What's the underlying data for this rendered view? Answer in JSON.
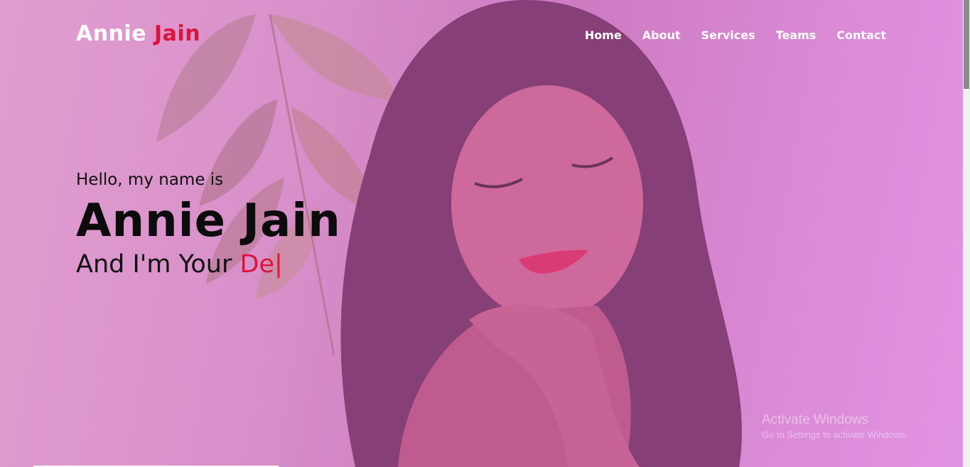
{
  "colors": {
    "accent": "#dc143c",
    "overlay": "#d68fc6",
    "text_dark": "#0c0c0c",
    "nav_text": "#ffffff"
  },
  "logo": {
    "first": "Annie",
    "second": "Jain"
  },
  "nav": {
    "items": [
      "Home",
      "About",
      "Services",
      "Teams",
      "Contact"
    ]
  },
  "hero": {
    "greeting": "Hello, my name is",
    "name": "Annie Jain",
    "tagline_prefix": "And I'm Your",
    "typed_text": "De",
    "cursor": "|"
  },
  "watermark": {
    "title": "Activate Windows",
    "subtitle": "Go to Settings to activate Windows."
  }
}
